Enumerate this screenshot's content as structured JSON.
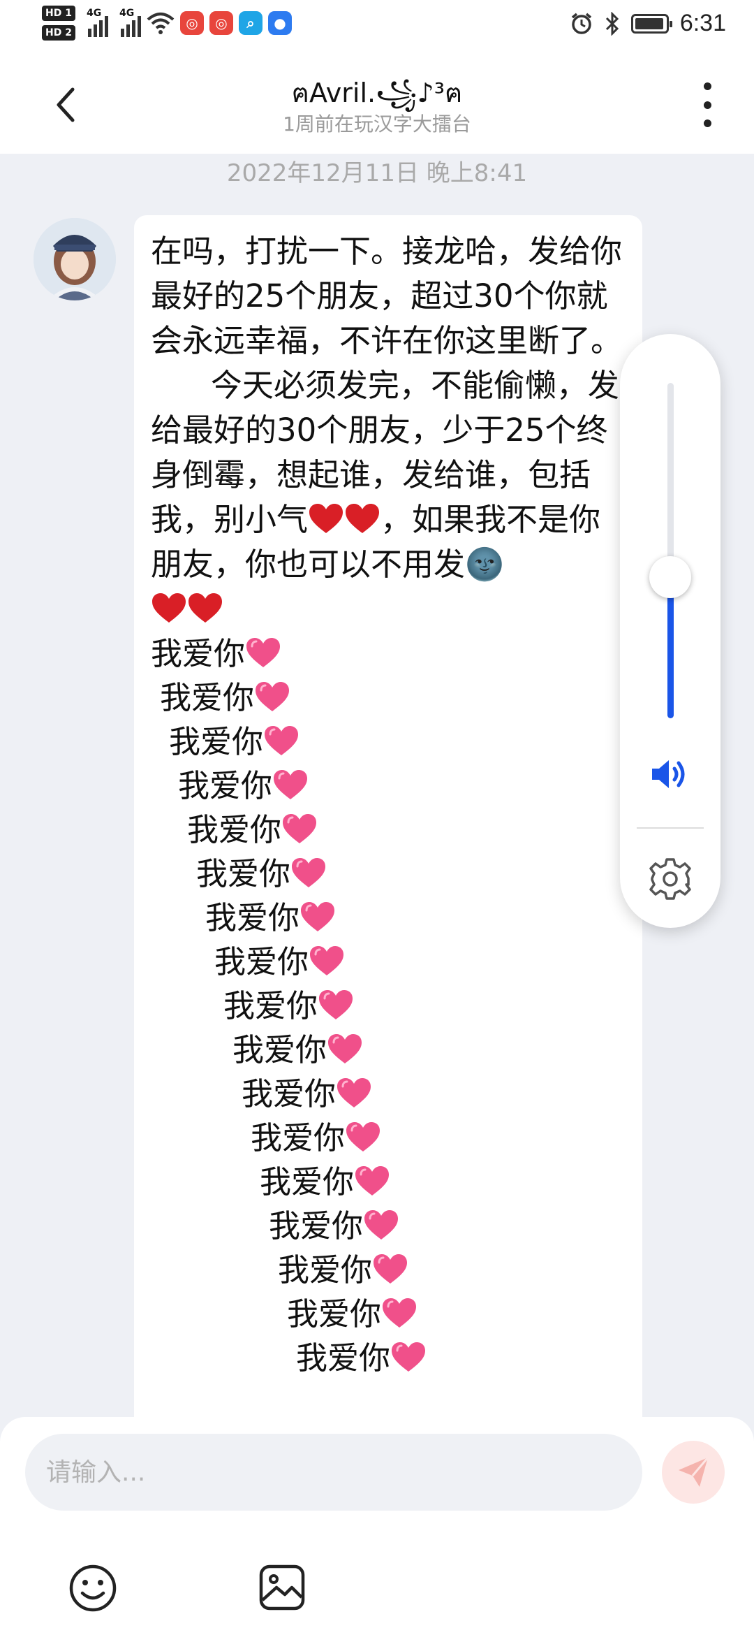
{
  "status_bar": {
    "sim1": "HD 1",
    "sim2": "HD 2",
    "network1": "4G",
    "network2": "4G",
    "time": "6:31"
  },
  "header": {
    "title": "ฅAvril.꧁♪³ฅ",
    "subtitle": "1周前在玩汉字大擂台"
  },
  "chat": {
    "date": "2022年12月11日 晚上8:41",
    "message": {
      "part1": "在吗，打扰一下。接龙哈，发给你最好的25个朋友，超过30个你就会永远幸福，不许在你这里断了。\n      今天必须发完，不能偷懒，发给最好的30个朋友，少于25个终身倒霉，想起谁，发给谁，包括我，别小气",
      "part2": "，如果我不是你朋友，你也可以不用发",
      "emoji_dark": "🌚",
      "love_lines": [
        "我爱你",
        "我爱你",
        "我爱你",
        "我爱你",
        "我爱你",
        "我爱你",
        "我爱你",
        "我爱你",
        "我爱你",
        "我爱你",
        "我爱你",
        "我爱你",
        "我爱你",
        "我爱你",
        "我爱你",
        "我爱你",
        "我爱你"
      ]
    }
  },
  "volume": {
    "level": 0.42,
    "accent": "#1a55e8"
  },
  "input": {
    "placeholder": "请输入..."
  },
  "icons": {
    "back": "chevron-left-icon",
    "more": "more-vertical-icon",
    "send": "send-icon",
    "emoji": "smiley-icon",
    "image": "image-icon",
    "speaker": "speaker-icon",
    "settings": "gear-icon"
  }
}
